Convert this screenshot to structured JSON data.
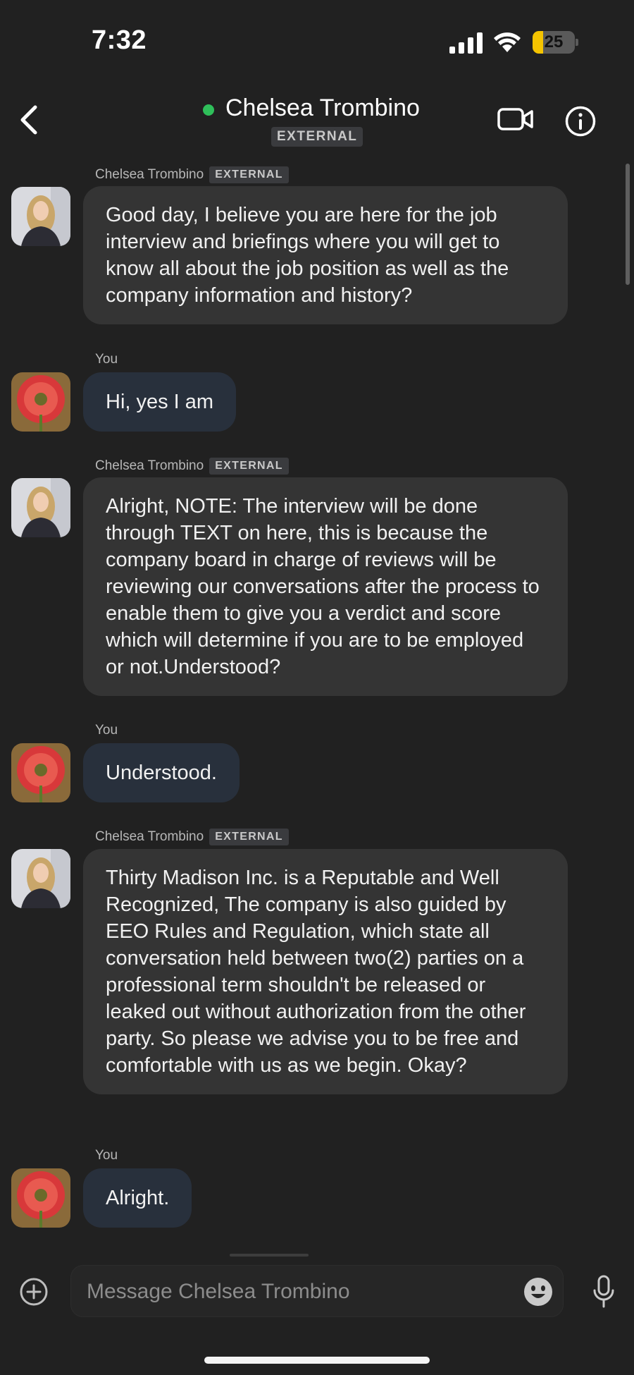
{
  "status_bar": {
    "time": "7:32",
    "battery_level": "25"
  },
  "header": {
    "contact_name": "Chelsea Trombino",
    "external_label": "EXTERNAL",
    "online": true,
    "online_color": "#2fbf5a"
  },
  "messages": [
    {
      "sender": "Chelsea Trombino",
      "badge": "EXTERNAL",
      "from": "them",
      "text": "Good day, I believe you are here for the job interview and briefings where you will get to know all about the job position as well as the company information and history?"
    },
    {
      "sender": "You",
      "badge": "",
      "from": "me",
      "text": "Hi, yes I am"
    },
    {
      "sender": "Chelsea Trombino",
      "badge": "EXTERNAL",
      "from": "them",
      "text": "Alright, NOTE: The interview will be done through TEXT on here, this is because the company board in charge of reviews will be reviewing our conversations after the process to enable them to give you a verdict and score which will determine if you are to be employed or not.Understood?"
    },
    {
      "sender": "You",
      "badge": "",
      "from": "me",
      "text": "Understood."
    },
    {
      "sender": "Chelsea Trombino",
      "badge": "EXTERNAL",
      "from": "them",
      "text": "Thirty Madison Inc. is a Reputable and Well Recognized, The company is also guided by EEO Rules and Regulation, which state all conversation held between two(2) parties on a professional term shouldn't be released or leaked out without authorization from the other party. So please we advise you to be free and comfortable with us as we begin. Okay?"
    },
    {
      "sender": "You",
      "badge": "",
      "from": "me",
      "text": "Alright."
    }
  ],
  "composer": {
    "placeholder": "Message Chelsea Trombino",
    "value": ""
  },
  "colors": {
    "background": "#212121",
    "their_bubble": "#343434",
    "my_bubble": "#28303c",
    "battery_fill": "#f5c400"
  },
  "icons": [
    "back-chevron-icon",
    "video-camera-icon",
    "info-icon",
    "plus-circle-icon",
    "emoji-icon",
    "microphone-icon"
  ]
}
